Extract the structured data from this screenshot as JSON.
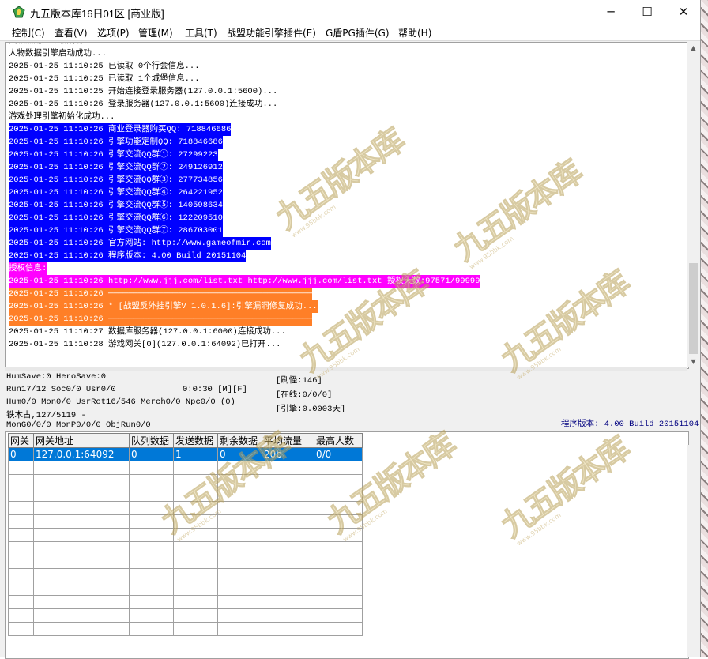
{
  "window": {
    "title": "九五版本库16日01区 [商业版]",
    "controls": {
      "minimize": "─",
      "maximize": "☐",
      "close": "✕"
    }
  },
  "menu": [
    "控制(C)",
    "查看(V)",
    "选项(P)",
    "管理(M)",
    "工具(T)",
    "战盟功能引擎插件(E)",
    "G盾PG插件(G)",
    "帮助(H)"
  ],
  "log": [
    {
      "text": "回城点配置加载成功...",
      "style": "plain"
    },
    {
      "text": "人物数据引擎启动成功...",
      "style": "plain"
    },
    {
      "text": "2025-01-25 11:10:25 已读取 0个行会信息...",
      "style": "plain"
    },
    {
      "text": "2025-01-25 11:10:25 已读取 1个城堡信息...",
      "style": "plain"
    },
    {
      "text": "2025-01-25 11:10:25 开始连接登录服务器(127.0.0.1:5600)...",
      "style": "plain"
    },
    {
      "text": "2025-01-25 11:10:26 登录服务器(127.0.0.1:5600)连接成功...",
      "style": "plain"
    },
    {
      "text": "游戏处理引擎初始化成功...",
      "style": "plain"
    },
    {
      "text": "2025-01-25 11:10:26 商业登录器购买QQ: 718846686",
      "style": "blue"
    },
    {
      "text": "2025-01-25 11:10:26 引擎功能定制QQ: 718846686",
      "style": "blue"
    },
    {
      "text": "2025-01-25 11:10:26 引擎交流QQ群①: 27299223",
      "style": "blue"
    },
    {
      "text": "2025-01-25 11:10:26 引擎交流QQ群②: 249126912",
      "style": "blue"
    },
    {
      "text": "2025-01-25 11:10:26 引擎交流QQ群③: 277734856",
      "style": "blue"
    },
    {
      "text": "2025-01-25 11:10:26 引擎交流QQ群④: 264221952",
      "style": "blue"
    },
    {
      "text": "2025-01-25 11:10:26 引擎交流QQ群⑤: 140598634",
      "style": "blue"
    },
    {
      "text": "2025-01-25 11:10:26 引擎交流QQ群⑥: 122209510",
      "style": "blue"
    },
    {
      "text": "2025-01-25 11:10:26 引擎交流QQ群⑦: 286703001",
      "style": "blue"
    },
    {
      "text": "2025-01-25 11:10:26 官方网站: http://www.gameofmir.com",
      "style": "blue"
    },
    {
      "text": "2025-01-25 11:10:26 程序版本: 4.00 Build 20151104",
      "style": "blue"
    },
    {
      "text": "授权信息:",
      "style": "magenta"
    },
    {
      "text": "2025-01-25 11:10:26 http://www.jjj.com/list.txt http://www.jjj.com/list.txt 授权天数:97571/99999",
      "style": "magenta"
    },
    {
      "text": "2025-01-25 11:10:26 ─────────────────────────────────────────",
      "style": "orange"
    },
    {
      "text": "2025-01-25 11:10:26 * [战盟反外挂引擎V 1.0.1.6]:引擎漏洞修复成功...",
      "style": "orange"
    },
    {
      "text": "2025-01-25 11:10:26 ─────────────────────────────────────────",
      "style": "orange"
    },
    {
      "text": "2025-01-25 11:10:27 数据库服务器(127.0.0.1:6000)连接成功...",
      "style": "plain"
    },
    {
      "text": "2025-01-25 11:10:28 游戏网关[0](127.0.0.1:64092)已打开...",
      "style": "plain"
    }
  ],
  "status": {
    "hum_save": "HumSave:0 HeroSave:0",
    "run": "Run17/12 Soc0/0 Usr0/0",
    "runtime": "0:0:30 [M][F]",
    "hum": "Hum0/0 Mon0/0 UsrRot16/546 Merch0/0 Npc0/0 (0)",
    "iron": "铁木占,127/5119 -",
    "mon_gen": "MonG0/0/0 MonP0/0/0 ObjRun0/0",
    "refresh": "[刷怪:146]",
    "online": "[在线:0/0/0]",
    "engine": "[引擎:0.0003天]",
    "version": "程序版本: 4.00 Build 20151104"
  },
  "gateway_table": {
    "columns": [
      "网关",
      "网关地址",
      "队列数据",
      "发送数据",
      "剩余数据",
      "平均流量",
      "最高人数"
    ],
    "rows": [
      [
        "0",
        "127.0.0.1:64092",
        "0",
        "1",
        "0",
        "20b",
        "0/0"
      ]
    ]
  },
  "watermark": {
    "text": "九五版本库",
    "sub": "www.95bbk.com"
  },
  "colors": {
    "highlight_blue": "#0000ff",
    "highlight_magenta": "#ff00ff",
    "highlight_orange": "#ff7f27",
    "selection": "#0078d7",
    "version_text": "#000080"
  }
}
